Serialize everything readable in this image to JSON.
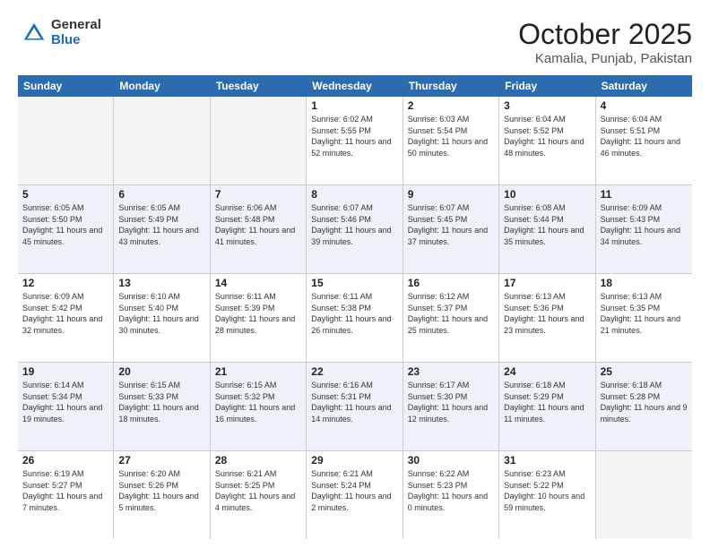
{
  "logo": {
    "general": "General",
    "blue": "Blue"
  },
  "title": "October 2025",
  "location": "Kamalia, Punjab, Pakistan",
  "weekdays": [
    "Sunday",
    "Monday",
    "Tuesday",
    "Wednesday",
    "Thursday",
    "Friday",
    "Saturday"
  ],
  "rows": [
    {
      "alt": false,
      "cells": [
        {
          "day": "",
          "info": ""
        },
        {
          "day": "",
          "info": ""
        },
        {
          "day": "",
          "info": ""
        },
        {
          "day": "1",
          "info": "Sunrise: 6:02 AM\nSunset: 5:55 PM\nDaylight: 11 hours and 52 minutes."
        },
        {
          "day": "2",
          "info": "Sunrise: 6:03 AM\nSunset: 5:54 PM\nDaylight: 11 hours and 50 minutes."
        },
        {
          "day": "3",
          "info": "Sunrise: 6:04 AM\nSunset: 5:52 PM\nDaylight: 11 hours and 48 minutes."
        },
        {
          "day": "4",
          "info": "Sunrise: 6:04 AM\nSunset: 5:51 PM\nDaylight: 11 hours and 46 minutes."
        }
      ]
    },
    {
      "alt": true,
      "cells": [
        {
          "day": "5",
          "info": "Sunrise: 6:05 AM\nSunset: 5:50 PM\nDaylight: 11 hours and 45 minutes."
        },
        {
          "day": "6",
          "info": "Sunrise: 6:05 AM\nSunset: 5:49 PM\nDaylight: 11 hours and 43 minutes."
        },
        {
          "day": "7",
          "info": "Sunrise: 6:06 AM\nSunset: 5:48 PM\nDaylight: 11 hours and 41 minutes."
        },
        {
          "day": "8",
          "info": "Sunrise: 6:07 AM\nSunset: 5:46 PM\nDaylight: 11 hours and 39 minutes."
        },
        {
          "day": "9",
          "info": "Sunrise: 6:07 AM\nSunset: 5:45 PM\nDaylight: 11 hours and 37 minutes."
        },
        {
          "day": "10",
          "info": "Sunrise: 6:08 AM\nSunset: 5:44 PM\nDaylight: 11 hours and 35 minutes."
        },
        {
          "day": "11",
          "info": "Sunrise: 6:09 AM\nSunset: 5:43 PM\nDaylight: 11 hours and 34 minutes."
        }
      ]
    },
    {
      "alt": false,
      "cells": [
        {
          "day": "12",
          "info": "Sunrise: 6:09 AM\nSunset: 5:42 PM\nDaylight: 11 hours and 32 minutes."
        },
        {
          "day": "13",
          "info": "Sunrise: 6:10 AM\nSunset: 5:40 PM\nDaylight: 11 hours and 30 minutes."
        },
        {
          "day": "14",
          "info": "Sunrise: 6:11 AM\nSunset: 5:39 PM\nDaylight: 11 hours and 28 minutes."
        },
        {
          "day": "15",
          "info": "Sunrise: 6:11 AM\nSunset: 5:38 PM\nDaylight: 11 hours and 26 minutes."
        },
        {
          "day": "16",
          "info": "Sunrise: 6:12 AM\nSunset: 5:37 PM\nDaylight: 11 hours and 25 minutes."
        },
        {
          "day": "17",
          "info": "Sunrise: 6:13 AM\nSunset: 5:36 PM\nDaylight: 11 hours and 23 minutes."
        },
        {
          "day": "18",
          "info": "Sunrise: 6:13 AM\nSunset: 5:35 PM\nDaylight: 11 hours and 21 minutes."
        }
      ]
    },
    {
      "alt": true,
      "cells": [
        {
          "day": "19",
          "info": "Sunrise: 6:14 AM\nSunset: 5:34 PM\nDaylight: 11 hours and 19 minutes."
        },
        {
          "day": "20",
          "info": "Sunrise: 6:15 AM\nSunset: 5:33 PM\nDaylight: 11 hours and 18 minutes."
        },
        {
          "day": "21",
          "info": "Sunrise: 6:15 AM\nSunset: 5:32 PM\nDaylight: 11 hours and 16 minutes."
        },
        {
          "day": "22",
          "info": "Sunrise: 6:16 AM\nSunset: 5:31 PM\nDaylight: 11 hours and 14 minutes."
        },
        {
          "day": "23",
          "info": "Sunrise: 6:17 AM\nSunset: 5:30 PM\nDaylight: 11 hours and 12 minutes."
        },
        {
          "day": "24",
          "info": "Sunrise: 6:18 AM\nSunset: 5:29 PM\nDaylight: 11 hours and 11 minutes."
        },
        {
          "day": "25",
          "info": "Sunrise: 6:18 AM\nSunset: 5:28 PM\nDaylight: 11 hours and 9 minutes."
        }
      ]
    },
    {
      "alt": false,
      "cells": [
        {
          "day": "26",
          "info": "Sunrise: 6:19 AM\nSunset: 5:27 PM\nDaylight: 11 hours and 7 minutes."
        },
        {
          "day": "27",
          "info": "Sunrise: 6:20 AM\nSunset: 5:26 PM\nDaylight: 11 hours and 5 minutes."
        },
        {
          "day": "28",
          "info": "Sunrise: 6:21 AM\nSunset: 5:25 PM\nDaylight: 11 hours and 4 minutes."
        },
        {
          "day": "29",
          "info": "Sunrise: 6:21 AM\nSunset: 5:24 PM\nDaylight: 11 hours and 2 minutes."
        },
        {
          "day": "30",
          "info": "Sunrise: 6:22 AM\nSunset: 5:23 PM\nDaylight: 11 hours and 0 minutes."
        },
        {
          "day": "31",
          "info": "Sunrise: 6:23 AM\nSunset: 5:22 PM\nDaylight: 10 hours and 59 minutes."
        },
        {
          "day": "",
          "info": ""
        }
      ]
    }
  ]
}
